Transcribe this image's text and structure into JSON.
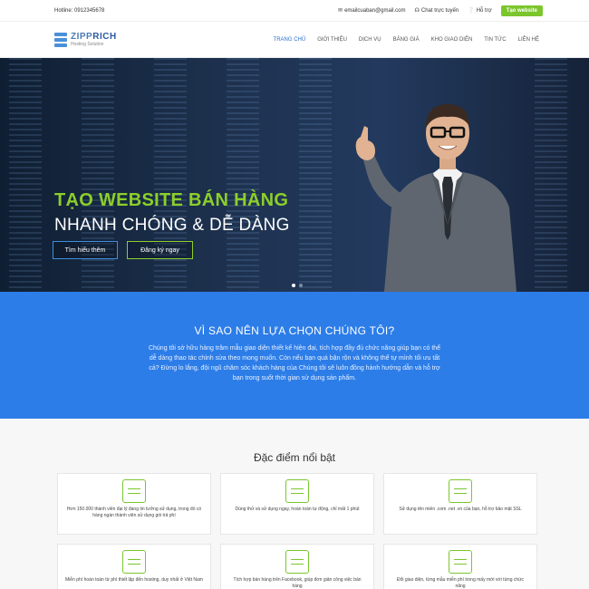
{
  "topbar": {
    "hotline": "Hotline: 0912345678",
    "email": "emailcuaban@gmail.com",
    "chat": "Chat trực tuyến",
    "support": "Hỗ trợ",
    "cta": "Tạo website"
  },
  "brand": {
    "name_a": "ZIPP",
    "name_b": "RICH",
    "tagline": "Hosting Solution"
  },
  "nav": [
    "TRANG CHỦ",
    "GIỚI THIỆU",
    "DỊCH VỤ",
    "BẢNG GIÁ",
    "KHO GIAO DIỆN",
    "TIN TỨC",
    "LIÊN HỆ"
  ],
  "hero": {
    "title_line1": "TẠO WEBSITE BÁN HÀNG",
    "title_line2": "NHANH CHÓNG & DỄ DÀNG",
    "btn_learn": "Tìm hiểu thêm",
    "btn_register": "Đăng ký ngay"
  },
  "why": {
    "heading": "VÌ SAO NÊN LỰA CHỌN CHÚNG TÔI?",
    "body": "Chúng tôi sở hữu hàng trăm mẫu giao diện thiết kế hiện đại, tích hợp đầy đủ chức năng giúp bạn có thể dễ dàng thao tác chỉnh sửa theo mong muốn. Còn nếu bạn quá bận rộn và không thể tự mình tối ưu tất cả? Đừng lo lắng, đội ngũ chăm sóc khách hàng của Chúng tôi sẽ luôn đồng hành hướng dẫn và hỗ trợ bạn trong suốt thời gian sử dụng sản phẩm."
  },
  "features": {
    "heading": "Đặc điểm nổi bật",
    "items": [
      {
        "icon": "people-network-icon",
        "text": "Hơn 150.000 thành viên đại lý đang tin tưởng sử dụng, trong đó có hàng ngàn thành viên sử dụng gói trả phí"
      },
      {
        "icon": "mobile-devices-icon",
        "text": "Dùng thử và sử dụng ngay, hoàn toàn tự động, chỉ mất 1 phút"
      },
      {
        "icon": "domain-ssl-icon",
        "text": "Sử dụng tên miền .com .net .vn của bạn, hỗ trợ bảo mật SSL"
      },
      {
        "icon": "plant-growth-icon",
        "text": "Miễn phí hoàn toàn từ phí thiết lập đến hosting, duy nhất ở Việt Nam"
      },
      {
        "icon": "facebook-integration-icon",
        "text": "Tích hợp bán hàng trên Facebook, giúp đơn giản công việc bán hàng"
      },
      {
        "icon": "theme-settings-icon",
        "text": "Đổi giao diện, từng mẫu miễn phí trong mấy mới với từng chức năng"
      }
    ]
  },
  "colors": {
    "green": "#7bc62d",
    "blue": "#2c7de8",
    "nav_active": "#2a6ecb"
  }
}
